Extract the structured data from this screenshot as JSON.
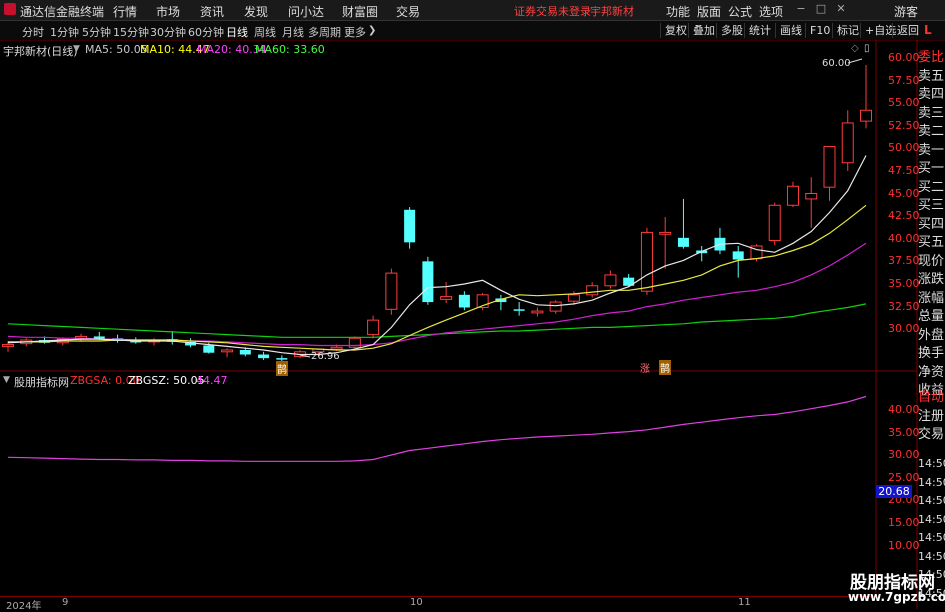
{
  "titlebar": {
    "app_name": "通达信金融终端",
    "menus": [
      "行情",
      "市场",
      "资讯",
      "发现",
      "问小达",
      "财富圈",
      "交易"
    ],
    "warning": "证券交易未登录",
    "stock_name": "宇邦新材",
    "right_menus": [
      "功能",
      "版面",
      "公式",
      "选项"
    ],
    "guest": "游客"
  },
  "toolbar": {
    "timeframes": [
      "分时",
      "1分钟",
      "5分钟",
      "15分钟",
      "30分钟",
      "60分钟",
      "日线",
      "周线",
      "月线",
      "多周期",
      "更多"
    ],
    "active_timeframe": "日线",
    "buttons": [
      "复权",
      "叠加",
      "多股",
      "统计",
      "画线",
      "F10",
      "标记",
      "+自选",
      "返回"
    ]
  },
  "main_chart": {
    "title": "宇邦新材(日线)",
    "ma": [
      {
        "label": "MA5: 50.05",
        "color": "#ffffff"
      },
      {
        "label": "MA10: 44.47",
        "color": "#ffff00"
      },
      {
        "label": "MA20: 40.34",
        "color": "#ff00ff"
      },
      {
        "label": "MA60: 33.60",
        "color": "#00ff00"
      }
    ],
    "high_label": "60.00",
    "low_label": "26.96",
    "markers": [
      "涨",
      "涨",
      "鹊"
    ]
  },
  "sub_chart": {
    "title": "股朋指标网",
    "items": [
      {
        "label": "ZBGSA: 0.00",
        "color": "#ff3030"
      },
      {
        "label": "ZBGSZ: 50.05",
        "color": "#ffffff"
      },
      {
        "label": "44.47",
        "color": "#ff40ff"
      }
    ],
    "current_value": "20.68"
  },
  "axis": {
    "main_ticks": [
      "60.00",
      "57.50",
      "55.00",
      "52.50",
      "50.00",
      "47.50",
      "45.00",
      "42.50",
      "40.00",
      "37.50",
      "35.00",
      "32.50",
      "30.00"
    ],
    "sub_ticks": [
      "40.00",
      "35.00",
      "30.00",
      "25.00",
      "20.00",
      "15.00",
      "10.00"
    ],
    "date_labels": [
      "2024年",
      "9",
      "10",
      "11"
    ]
  },
  "sidebar": {
    "items_red": [
      "委比"
    ],
    "items_sell": [
      "卖五",
      "卖四",
      "卖三",
      "卖二",
      "卖一"
    ],
    "items_buy": [
      "买一",
      "买二",
      "买三",
      "买四",
      "买五"
    ],
    "items_info": [
      "现价",
      "涨跌",
      "涨幅",
      "总量",
      "外盘",
      "换手",
      "净资",
      "收益"
    ],
    "items_lower_red": [
      "自动"
    ],
    "items_lower": [
      "注册",
      "交易"
    ],
    "times": [
      "14:50",
      "14:50",
      "14:50",
      "14:50",
      "14:50",
      "14:50",
      "14:50",
      "14:50"
    ]
  },
  "chart_data": {
    "type": "candlestick",
    "ylim": [
      28.5,
      61
    ],
    "candles": [
      {
        "o": 28.9,
        "h": 29.5,
        "l": 28.3,
        "c": 29.1,
        "up": true
      },
      {
        "o": 29.2,
        "h": 29.8,
        "l": 28.9,
        "c": 29.6,
        "up": true
      },
      {
        "o": 29.6,
        "h": 30.0,
        "l": 29.2,
        "c": 29.3,
        "up": false
      },
      {
        "o": 29.3,
        "h": 29.9,
        "l": 29.0,
        "c": 29.7,
        "up": true
      },
      {
        "o": 29.7,
        "h": 30.3,
        "l": 29.4,
        "c": 30.0,
        "up": true
      },
      {
        "o": 30.0,
        "h": 30.5,
        "l": 29.6,
        "c": 29.7,
        "up": false
      },
      {
        "o": 29.8,
        "h": 30.2,
        "l": 29.3,
        "c": 29.5,
        "up": false
      },
      {
        "o": 29.5,
        "h": 29.9,
        "l": 29.2,
        "c": 29.4,
        "up": false
      },
      {
        "o": 29.4,
        "h": 29.8,
        "l": 29.0,
        "c": 29.6,
        "up": true
      },
      {
        "o": 29.7,
        "h": 30.6,
        "l": 29.1,
        "c": 29.4,
        "up": false
      },
      {
        "o": 29.4,
        "h": 29.8,
        "l": 28.8,
        "c": 29.0,
        "up": false
      },
      {
        "o": 29.0,
        "h": 29.3,
        "l": 28.1,
        "c": 28.2,
        "up": false
      },
      {
        "o": 28.3,
        "h": 28.7,
        "l": 27.7,
        "c": 28.5,
        "up": true
      },
      {
        "o": 28.5,
        "h": 28.8,
        "l": 27.8,
        "c": 28.0,
        "up": false
      },
      {
        "o": 28.0,
        "h": 28.3,
        "l": 27.4,
        "c": 27.6,
        "up": false
      },
      {
        "o": 27.6,
        "h": 27.9,
        "l": 27.0,
        "c": 27.5,
        "up": false
      },
      {
        "o": 27.8,
        "h": 28.5,
        "l": 27.6,
        "c": 28.3,
        "up": true
      },
      {
        "o": 28.3,
        "h": 28.7,
        "l": 28.0,
        "c": 28.6,
        "up": true
      },
      {
        "o": 28.6,
        "h": 29.1,
        "l": 28.4,
        "c": 28.8,
        "up": true
      },
      {
        "o": 28.8,
        "h": 30.0,
        "l": 28.6,
        "c": 29.8,
        "up": true
      },
      {
        "o": 30.2,
        "h": 32.3,
        "l": 29.8,
        "c": 31.8,
        "up": true
      },
      {
        "o": 33.0,
        "h": 37.5,
        "l": 32.4,
        "c": 37.0,
        "up": true
      },
      {
        "o": 44.0,
        "h": 44.3,
        "l": 39.7,
        "c": 40.4,
        "up": false
      },
      {
        "o": 38.3,
        "h": 38.8,
        "l": 33.5,
        "c": 33.8,
        "up": false
      },
      {
        "o": 34.1,
        "h": 36.0,
        "l": 33.7,
        "c": 34.4,
        "up": true
      },
      {
        "o": 34.6,
        "h": 35.0,
        "l": 32.9,
        "c": 33.2,
        "up": false
      },
      {
        "o": 33.2,
        "h": 34.8,
        "l": 32.9,
        "c": 34.6,
        "up": true
      },
      {
        "o": 34.2,
        "h": 34.6,
        "l": 32.9,
        "c": 33.8,
        "up": false
      },
      {
        "o": 33.0,
        "h": 33.8,
        "l": 32.3,
        "c": 33.0,
        "up": false
      },
      {
        "o": 32.6,
        "h": 33.2,
        "l": 32.2,
        "c": 32.8,
        "up": true
      },
      {
        "o": 32.8,
        "h": 34.0,
        "l": 32.5,
        "c": 33.8,
        "up": true
      },
      {
        "o": 33.9,
        "h": 35.0,
        "l": 33.5,
        "c": 34.6,
        "up": true
      },
      {
        "o": 34.6,
        "h": 36.0,
        "l": 34.3,
        "c": 35.6,
        "up": true
      },
      {
        "o": 35.6,
        "h": 37.3,
        "l": 35.3,
        "c": 36.8,
        "up": true
      },
      {
        "o": 36.5,
        "h": 36.9,
        "l": 35.5,
        "c": 35.6,
        "up": false
      },
      {
        "o": 35.0,
        "h": 42.0,
        "l": 34.6,
        "c": 41.5,
        "up": true
      },
      {
        "o": 41.5,
        "h": 43.2,
        "l": 37.5,
        "c": 41.3,
        "up": true
      },
      {
        "o": 40.9,
        "h": 45.2,
        "l": 39.7,
        "c": 39.9,
        "up": false
      },
      {
        "o": 39.5,
        "h": 40.0,
        "l": 38.3,
        "c": 39.2,
        "up": false
      },
      {
        "o": 40.9,
        "h": 42.0,
        "l": 39.1,
        "c": 39.5,
        "up": false
      },
      {
        "o": 39.4,
        "h": 40.0,
        "l": 36.5,
        "c": 38.5,
        "up": false
      },
      {
        "o": 38.6,
        "h": 40.2,
        "l": 38.3,
        "c": 40.0,
        "up": true
      },
      {
        "o": 40.6,
        "h": 44.8,
        "l": 40.1,
        "c": 44.5,
        "up": true
      },
      {
        "o": 44.5,
        "h": 47.1,
        "l": 44.3,
        "c": 46.6,
        "up": true
      },
      {
        "o": 45.2,
        "h": 47.6,
        "l": 42.0,
        "c": 45.8,
        "up": true
      },
      {
        "o": 46.5,
        "h": 51.0,
        "l": 45.0,
        "c": 51.0,
        "up": true
      },
      {
        "o": 49.2,
        "h": 55.0,
        "l": 48.3,
        "c": 53.6,
        "up": true
      },
      {
        "o": 53.8,
        "h": 60.0,
        "l": 53.0,
        "c": 55.0,
        "up": true
      }
    ],
    "ma5": [
      29.3,
      29.4,
      29.5,
      29.6,
      29.7,
      29.7,
      29.6,
      29.5,
      29.5,
      29.5,
      29.3,
      29.1,
      28.9,
      28.7,
      28.5,
      28.2,
      28.0,
      28.0,
      28.2,
      28.6,
      29.1,
      31.0,
      33.5,
      35.4,
      35.5,
      35.8,
      36.2,
      35.1,
      34.1,
      33.5,
      33.4,
      33.6,
      34.0,
      34.8,
      35.5,
      36.8,
      37.8,
      38.4,
      39.4,
      40.2,
      40.3,
      39.6,
      39.3,
      40.3,
      41.6,
      43.7,
      46.1,
      50.0
    ],
    "ma10": [
      29.4,
      29.4,
      29.4,
      29.5,
      29.5,
      29.5,
      29.6,
      29.6,
      29.6,
      29.6,
      29.5,
      29.4,
      29.3,
      29.1,
      28.9,
      28.8,
      28.7,
      28.6,
      28.5,
      28.5,
      28.7,
      29.2,
      30.1,
      31.0,
      31.8,
      32.6,
      33.4,
      34.1,
      34.6,
      34.5,
      34.6,
      34.7,
      34.9,
      35.1,
      35.1,
      35.4,
      35.8,
      36.2,
      36.8,
      37.8,
      38.4,
      38.6,
      38.9,
      39.5,
      40.2,
      41.4,
      42.9,
      44.5
    ],
    "ma20": [
      30.0,
      29.9,
      29.9,
      29.8,
      29.8,
      29.7,
      29.7,
      29.6,
      29.6,
      29.6,
      29.5,
      29.5,
      29.4,
      29.3,
      29.2,
      29.1,
      29.1,
      29.0,
      29.0,
      29.0,
      29.1,
      29.3,
      29.7,
      30.1,
      30.4,
      30.6,
      30.8,
      31.0,
      31.2,
      31.4,
      31.6,
      31.9,
      32.3,
      32.6,
      32.8,
      33.3,
      33.6,
      34.0,
      34.3,
      34.6,
      34.9,
      35.1,
      35.5,
      36.0,
      36.8,
      37.8,
      39.0,
      40.3
    ],
    "ma60": [
      31.4,
      31.3,
      31.2,
      31.1,
      31.0,
      30.9,
      30.8,
      30.7,
      30.6,
      30.5,
      30.4,
      30.3,
      30.2,
      30.1,
      30.0,
      29.9,
      29.9,
      29.9,
      29.9,
      29.9,
      29.9,
      30.0,
      30.1,
      30.2,
      30.3,
      30.4,
      30.5,
      30.6,
      30.6,
      30.7,
      30.8,
      30.9,
      31.0,
      31.0,
      31.1,
      31.2,
      31.3,
      31.4,
      31.6,
      31.7,
      31.8,
      31.9,
      32.0,
      32.2,
      32.6,
      32.9,
      33.2,
      33.6
    ],
    "sub_ylim": [
      7,
      49
    ],
    "sub_line": [
      29.5,
      29.4,
      29.3,
      29.2,
      29.1,
      29.0,
      29.0,
      28.9,
      28.9,
      28.8,
      28.8,
      28.7,
      28.7,
      28.6,
      28.6,
      28.6,
      28.6,
      28.6,
      28.6,
      28.7,
      29.0,
      30.0,
      31.0,
      31.5,
      32.0,
      32.5,
      33.0,
      33.4,
      33.7,
      34.0,
      34.2,
      34.4,
      34.6,
      34.9,
      35.2,
      35.6,
      36.2,
      36.8,
      37.3,
      37.8,
      38.3,
      38.7,
      39.0,
      39.6,
      40.3,
      41.0,
      41.8,
      43.0
    ]
  }
}
